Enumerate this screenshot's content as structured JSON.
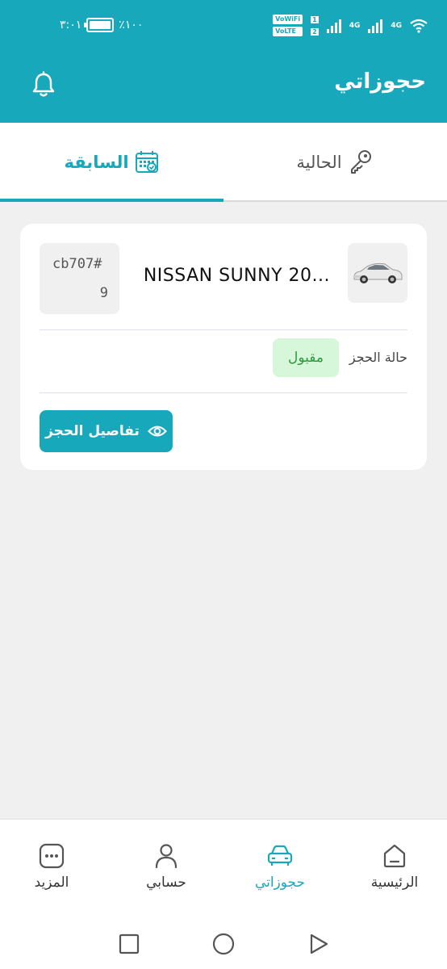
{
  "status_bar": {
    "time": "٣:٠١",
    "battery": "٪١٠٠",
    "network_1": "4G",
    "network_2": "4G",
    "vowifi": "VoWiFi",
    "volte": "VoLTE",
    "sim_1": "1",
    "sim_2": "2"
  },
  "header": {
    "title": "حجوزاتي"
  },
  "tabs": {
    "current": "الحالية",
    "previous": "السابقة"
  },
  "booking": {
    "car_name": "NISSAN SUNNY 20...",
    "booking_no_line1": "cb707#",
    "booking_no_line2": "9",
    "status_label": "حالة الحجز",
    "status_value": "مقبول",
    "details_button": "تفاصيل الحجز"
  },
  "bottom_nav": {
    "home": "الرئيسية",
    "bookings": "حجوزاتي",
    "account": "حسابي",
    "more": "المزيد"
  },
  "colors": {
    "accent": "#18a8bb",
    "status_bg": "#d6f7d9",
    "status_text": "#2b9b3d"
  }
}
